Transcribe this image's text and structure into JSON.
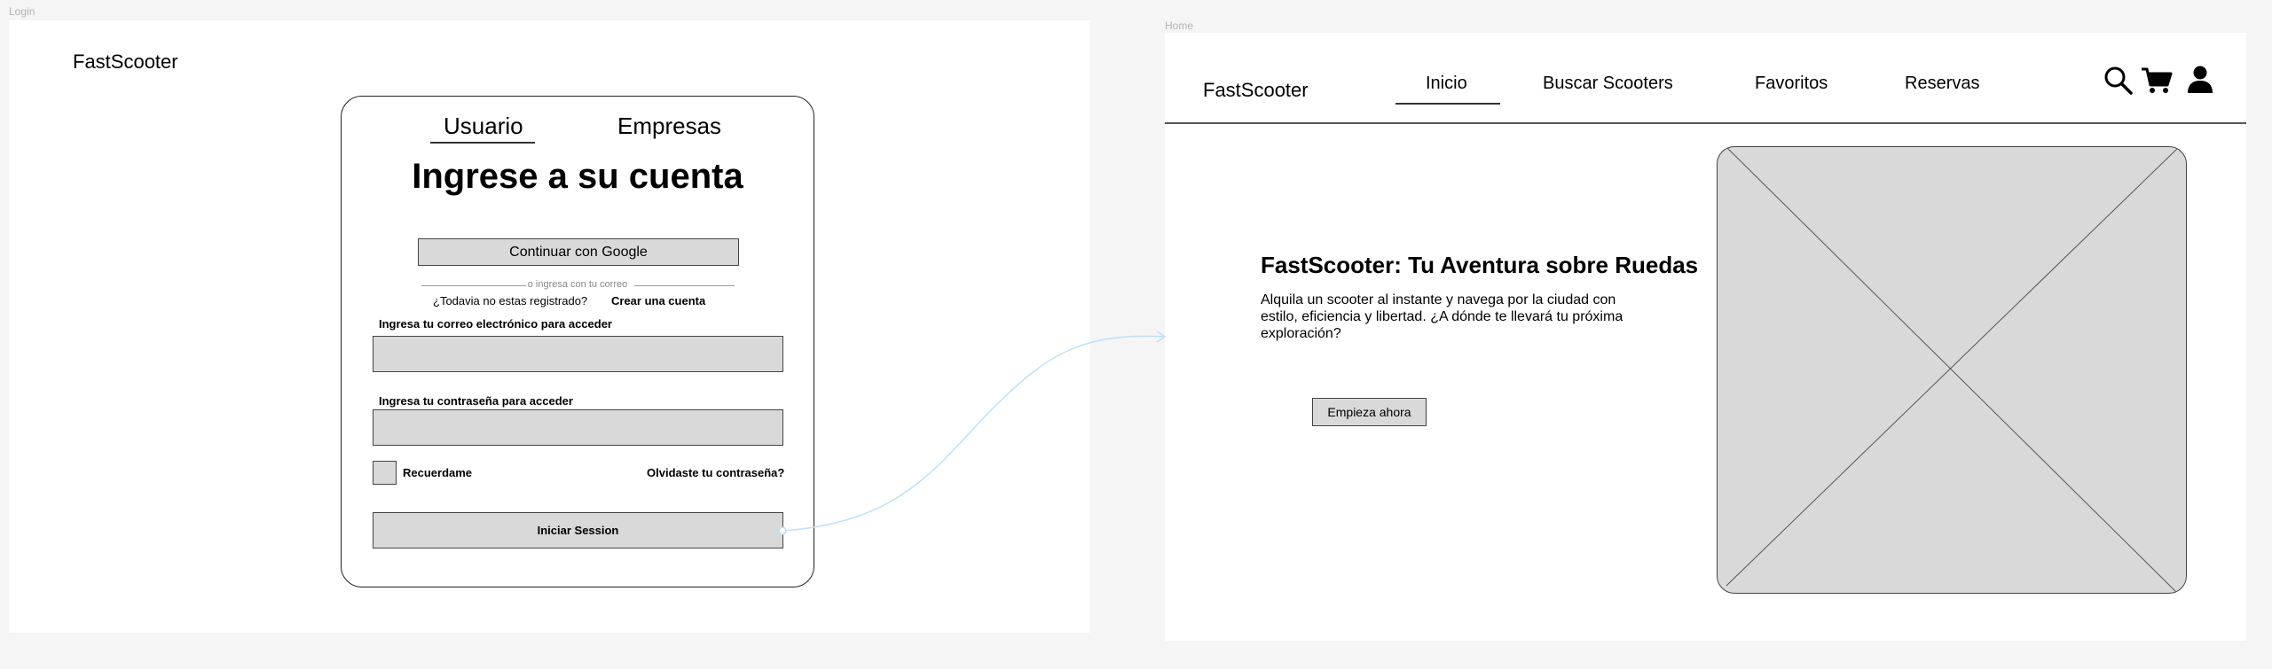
{
  "login": {
    "frame_label": "Login",
    "logo": "FastScooter",
    "tabs": [
      {
        "label": "Usuario",
        "active": true
      },
      {
        "label": "Empresas",
        "active": false
      }
    ],
    "title": "Ingrese a su cuenta",
    "google_button": "Continuar con Google",
    "divider_text": "o ingresa con tu correo",
    "register_prompt": "¿Todavia no estas registrado?",
    "register_link": "Crear una cuenta",
    "email_label": "Ingresa tu correo electrónico para acceder",
    "email_value": "",
    "password_label": "Ingresa tu contraseña para acceder",
    "password_value": "",
    "remember_label": "Recuerdame",
    "forgot_link": "Olvidaste tu contraseña?",
    "submit_button": "Iniciar Session"
  },
  "home": {
    "frame_label": "Home",
    "logo": "FastScooter",
    "nav": [
      {
        "label": "Inicio",
        "active": true
      },
      {
        "label": "Buscar Scooters",
        "active": false
      },
      {
        "label": "Favoritos",
        "active": false
      },
      {
        "label": "Reservas",
        "active": false
      }
    ],
    "icons": [
      "search-icon",
      "cart-icon",
      "user-icon"
    ],
    "hero_title": "FastScooter: Tu Aventura sobre Ruedas",
    "hero_text": "Alquila un scooter al instante y navega por la ciudad con estilo, eficiencia  y libertad. ¿A dónde te llevará tu próxima exploración?",
    "cta_button": "Empieza ahora"
  },
  "colors": {
    "canvas": "#f5f5f5",
    "frame": "#ffffff",
    "placeholder_fill": "#d9d9d9",
    "connector": "#bfe0f5"
  }
}
